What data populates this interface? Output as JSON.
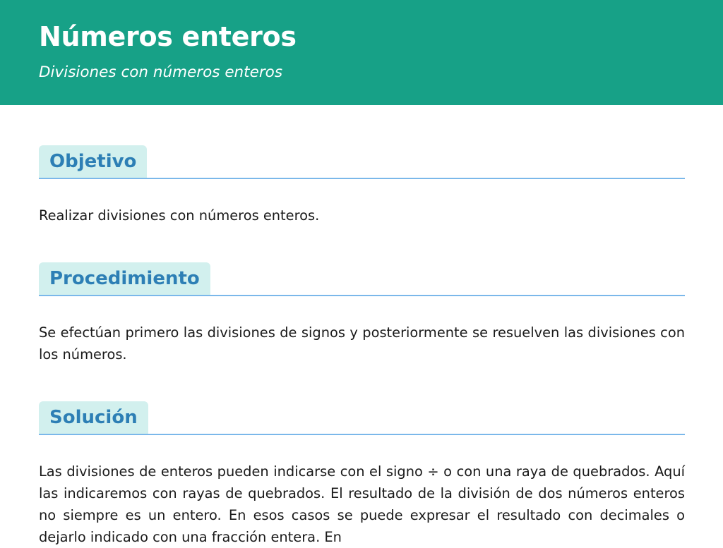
{
  "header": {
    "title": "Números enteros",
    "subtitle": "Divisiones con números enteros"
  },
  "sections": [
    {
      "heading": "Objetivo",
      "text": "Realizar divisiones con números enteros."
    },
    {
      "heading": "Procedimiento",
      "text": "Se efectúan primero las divisiones de signos y posteriormente se resuelven las divisiones con los números."
    },
    {
      "heading": "Solución",
      "text": "Las divisiones de enteros pueden indicarse con el signo ÷ o con una raya de quebrados. Aquí las indicaremos con rayas de quebrados. El resultado de la división de dos números enteros no siempre es un entero. En esos casos se puede expresar el resultado con decimales o dejarlo indicado con una fracción entera. En"
    }
  ],
  "colors": {
    "header_bg": "#17a187",
    "heading_tab_bg": "#d2f0ee",
    "heading_text": "#2d7fb5",
    "divider": "#7bb8ea"
  }
}
